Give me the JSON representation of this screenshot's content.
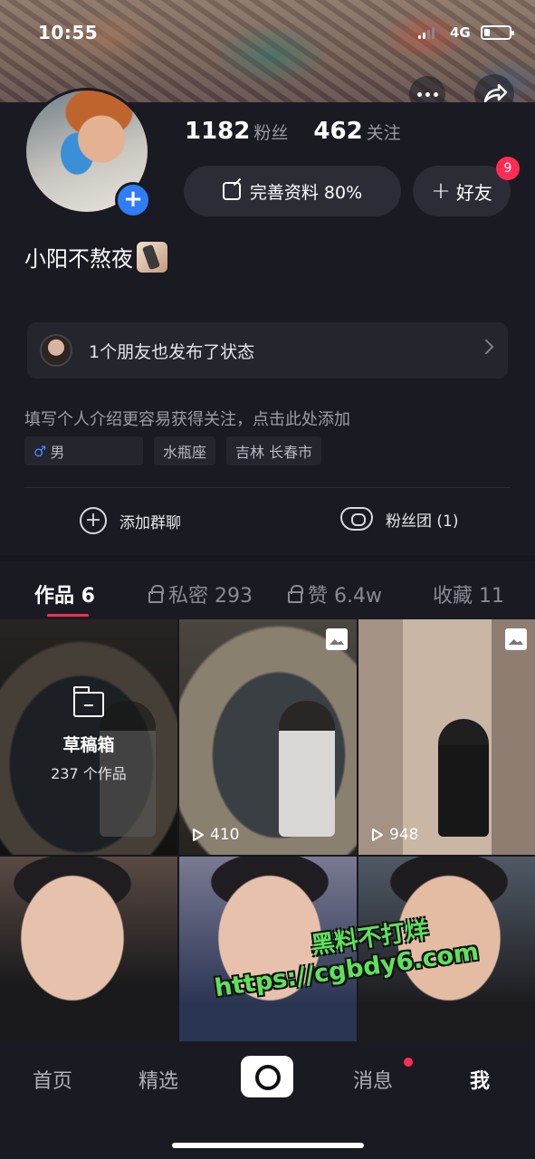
{
  "status": {
    "time": "10:55",
    "network": "4G"
  },
  "profile": {
    "followers_count": "1182",
    "followers_label": "粉丝",
    "following_count": "462",
    "following_label": "关注",
    "edit_profile_label": "完善资料 80%",
    "add_friend_label": "好友",
    "friend_badge": "9",
    "nickname": "小阳不熬夜",
    "friend_activity": "1个朋友也发布了状态",
    "bio_placeholder": "填写个人介绍更容易获得关注，点击此处添加",
    "tags": {
      "gender": "男",
      "zodiac": "水瓶座",
      "location": "吉林 长春市"
    }
  },
  "actions": {
    "group_chat": "添加群聊",
    "fan_club": "粉丝团 (1)"
  },
  "tabs": [
    {
      "label": "作品 6"
    },
    {
      "label": "私密 293"
    },
    {
      "label": "赞 6.4w"
    },
    {
      "label": "收藏 11"
    }
  ],
  "grid": {
    "draft_title": "草稿箱",
    "draft_count": "237 个作品",
    "play_counts": [
      "410",
      "948"
    ]
  },
  "watermark": {
    "line1": "黑料不打烊",
    "line2": "https://cgbdy6.com"
  },
  "bottom_nav": {
    "home": "首页",
    "featured": "精选",
    "messages": "消息",
    "me": "我"
  },
  "colors": {
    "accent": "#fe2c55",
    "blue": "#2f7cf6",
    "watermark": "#5ee25a",
    "background": "#1a1a22"
  },
  "icons": [
    "more-icon",
    "share-icon",
    "plus-icon",
    "edit-icon",
    "chevron-right-icon",
    "male-icon",
    "lock-icon",
    "folder-icon",
    "image-icon",
    "play-icon",
    "camera-icon"
  ]
}
